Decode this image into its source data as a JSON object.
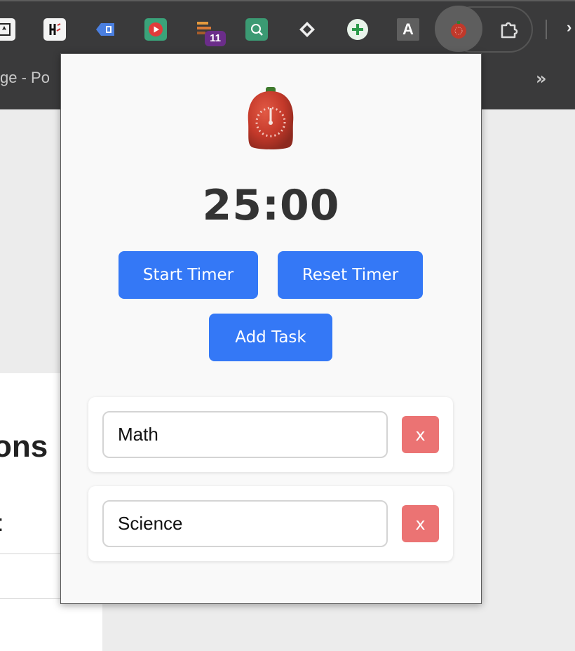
{
  "browser": {
    "bookmark_partial_text": "ge - Po",
    "overflow_chevron": "»",
    "edge_glyph": "›",
    "extensions": [
      {
        "name": "extension-1-icon"
      },
      {
        "name": "extension-2-icon"
      },
      {
        "name": "extension-3-icon"
      },
      {
        "name": "youtube-extension-icon"
      },
      {
        "name": "extension-5-icon",
        "badge": "11"
      },
      {
        "name": "extension-6-icon"
      },
      {
        "name": "diamond-extension-icon"
      },
      {
        "name": "plus-extension-icon"
      },
      {
        "name": "a-extension-icon",
        "letter": "A"
      },
      {
        "name": "tomato-timer-extension-icon"
      },
      {
        "name": "extensions-puzzle-icon"
      }
    ]
  },
  "page": {
    "heading_partial": "ons",
    "colon": ":"
  },
  "popup": {
    "logo": "tomato-timer-icon",
    "timer_display": "25:00",
    "start_label": "Start Timer",
    "reset_label": "Reset Timer",
    "add_label": "Add Task",
    "tasks": [
      {
        "value": "Math",
        "delete_label": "x"
      },
      {
        "value": "Science",
        "delete_label": "x"
      }
    ]
  },
  "colors": {
    "primary_button": "#3478f6",
    "delete_button": "#eb7373",
    "timer_text": "#333333",
    "toolbar": "#3a3a3b"
  }
}
